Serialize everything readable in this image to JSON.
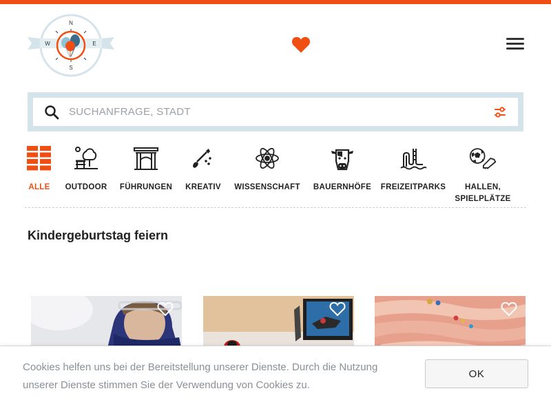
{
  "header": {
    "logo": {
      "compass_n": "N",
      "compass_e": "E",
      "compass_s": "S",
      "compass_w": "W"
    },
    "favorites_icon": "heart-icon",
    "menu_icon": "hamburger-menu-icon",
    "accent_color": "#f04e12"
  },
  "search": {
    "placeholder": "SUCHANFRAGE, STADT",
    "value": "",
    "search_icon": "search-icon",
    "filter_icon": "filter-sliders-icon"
  },
  "categories": [
    {
      "label": "ALLE",
      "icon": "grid-all-icon",
      "active": true
    },
    {
      "label": "OUTDOOR",
      "icon": "outdoor-bench-tree-icon",
      "active": false
    },
    {
      "label": "FÜHRUNGEN",
      "icon": "gate-monument-icon",
      "active": false
    },
    {
      "label": "KREATIV",
      "icon": "paintbrush-icon",
      "active": false
    },
    {
      "label": "WISSENSCHAFT",
      "icon": "atom-icon",
      "active": false
    },
    {
      "label": "BAUERNHÖFE",
      "icon": "cow-icon",
      "active": false
    },
    {
      "label": "FREIZEITPARKS",
      "icon": "water-slide-icon",
      "active": false
    },
    {
      "label": "HALLEN, SPIELPLÄTZE",
      "label_line1": "HALLEN,",
      "label_line2": "SPIELPLÄTZE",
      "icon": "ball-shoe-icon",
      "active": false
    }
  ],
  "main": {
    "section_title": "Kindergeburtstag feiern",
    "cards": [
      {
        "favorite_icon": "heart-outline-icon"
      },
      {
        "favorite_icon": "heart-outline-icon"
      },
      {
        "favorite_icon": "heart-outline-icon"
      }
    ]
  },
  "cookie_banner": {
    "text": "Cookies helfen uns bei der Bereitstellung unserer Dienste. Durch die Nutzung unserer Dienste stimmen Sie der Verwendung von Cookies zu.",
    "ok_label": "OK"
  }
}
